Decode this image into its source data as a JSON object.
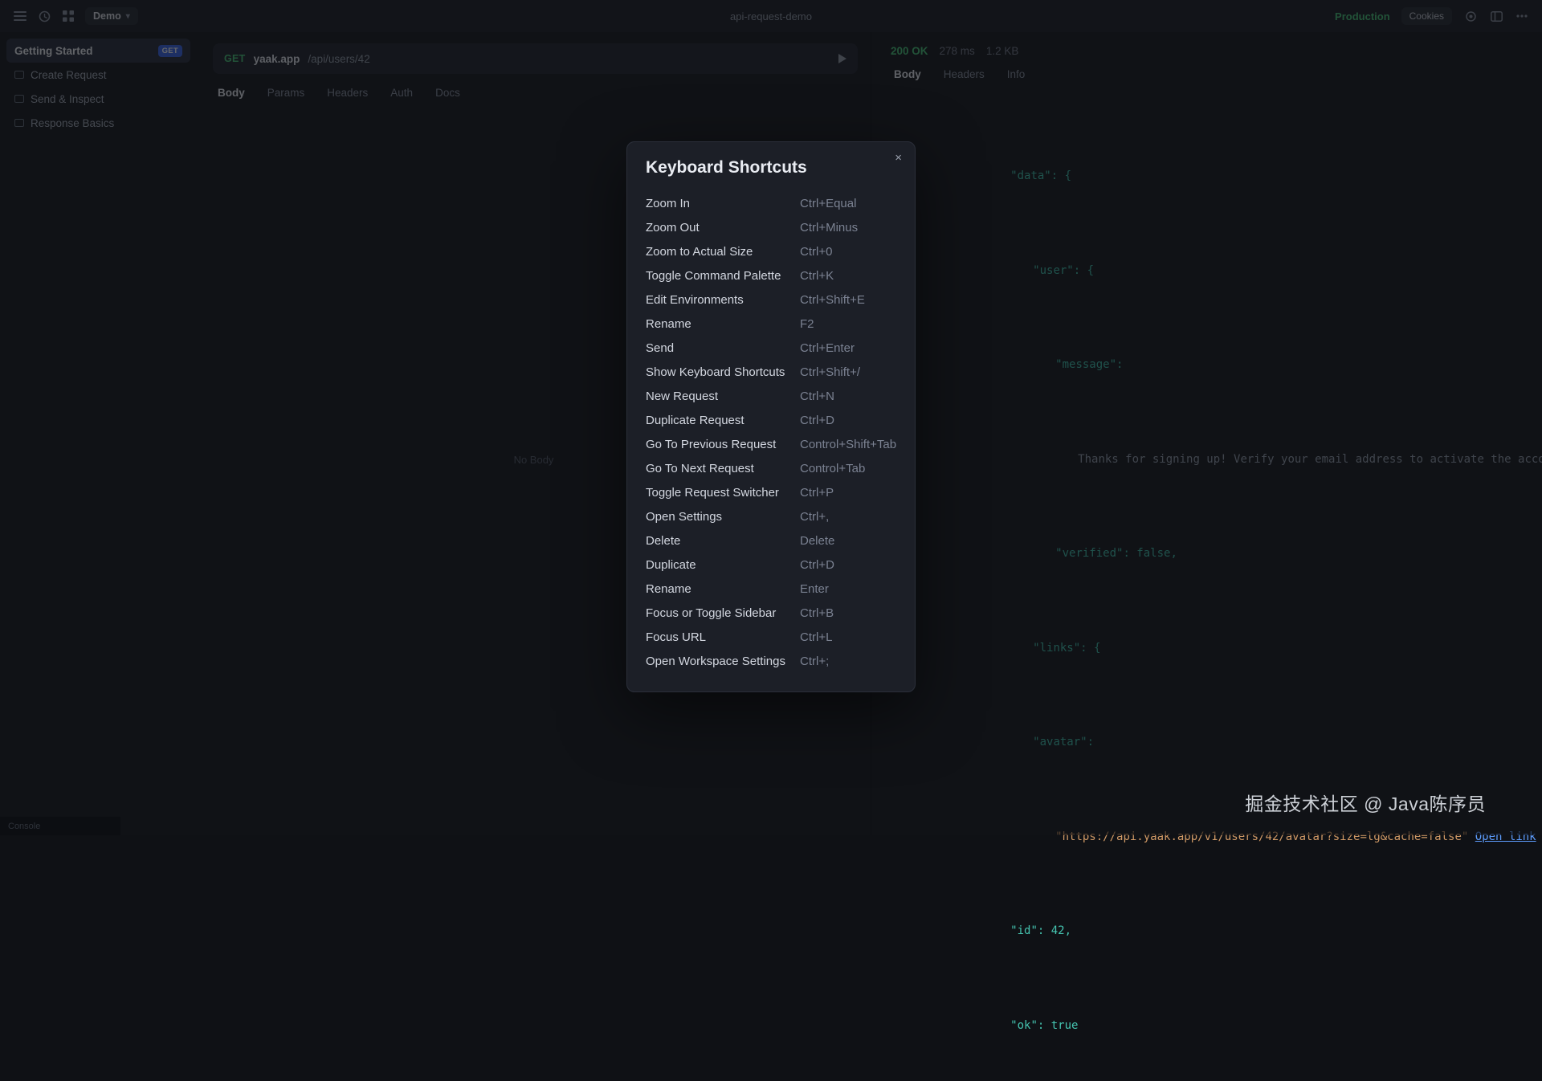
{
  "colors": {
    "accent_green": "#4ec97e",
    "method_green": "#4ec97e",
    "badge_blue": "#3f6cf0",
    "json_key": "#45c4b0",
    "json_string": "#d19a66",
    "json_link": "#5e9eff",
    "json_muted": "#9aa3b2"
  },
  "watermark": "掘金技术社区 @ Java陈序员",
  "topbar": {
    "workspace": "Demo",
    "document_title": "api-request-demo",
    "environment": "Production",
    "cookies_label": "Cookies"
  },
  "sidebar": {
    "items": [
      {
        "label": "Getting Started",
        "badge": "GET",
        "active": true
      },
      {
        "label": "Create Request",
        "icon": "folder"
      },
      {
        "label": "Send & Inspect",
        "icon": "folder"
      },
      {
        "label": "Response Basics",
        "icon": "file"
      }
    ]
  },
  "request": {
    "method": "GET",
    "url_host": "yaak.app",
    "url_path": "/api/users/42",
    "tabs": [
      {
        "label": "Body",
        "active": true
      },
      {
        "label": "Params"
      },
      {
        "label": "Headers"
      },
      {
        "label": "Auth"
      },
      {
        "label": "Docs"
      }
    ],
    "empty_state": "No Body"
  },
  "response": {
    "status": "200 OK",
    "time": "278 ms",
    "size": "1.2 KB",
    "tabs": [
      {
        "label": "Body",
        "active": true
      },
      {
        "label": "Headers"
      },
      {
        "label": "Info"
      }
    ],
    "body_lines": [
      {
        "indent": 0,
        "parts": [
          {
            "t": "\"data\": {",
            "c": "key"
          }
        ]
      },
      {
        "indent": 1,
        "parts": [
          {
            "t": "\"user\": {",
            "c": "key"
          }
        ]
      },
      {
        "indent": 2,
        "parts": [
          {
            "t": "\"message\":",
            "c": "key"
          }
        ]
      },
      {
        "indent": 3,
        "parts": [
          {
            "t": "Thanks for signing up! Verify your email address to activate the account.",
            "c": "muted"
          }
        ]
      },
      {
        "indent": 2,
        "parts": [
          {
            "t": "\"verified\": false,",
            "c": "key"
          }
        ]
      },
      {
        "indent": 1,
        "parts": [
          {
            "t": "\"links\": {",
            "c": "key"
          }
        ]
      },
      {
        "indent": 1,
        "parts": [
          {
            "t": "\"avatar\":",
            "c": "key"
          }
        ]
      },
      {
        "indent": 2,
        "parts": [
          {
            "t": "\"https://api.yaak.app/v1/users/42/avatar?size=lg&cache=false\" ",
            "c": "str"
          },
          {
            "t": "Open link",
            "c": "link"
          }
        ]
      },
      {
        "indent": 0,
        "parts": [
          {
            "t": "\"id\": 42,",
            "c": "key"
          }
        ]
      },
      {
        "indent": 0,
        "parts": [
          {
            "t": "\"ok\": true",
            "c": "key"
          }
        ]
      }
    ]
  },
  "statusbar": {
    "label": "Console"
  },
  "modal": {
    "title": "Keyboard Shortcuts",
    "close_label": "×",
    "shortcuts": [
      {
        "label": "Zoom In",
        "keys": "Ctrl+Equal"
      },
      {
        "label": "Zoom Out",
        "keys": "Ctrl+Minus"
      },
      {
        "label": "Zoom to Actual Size",
        "keys": "Ctrl+0"
      },
      {
        "label": "Toggle Command Palette",
        "keys": "Ctrl+K"
      },
      {
        "label": "Edit Environments",
        "keys": "Ctrl+Shift+E"
      },
      {
        "label": "Rename",
        "keys": "F2"
      },
      {
        "label": "Send",
        "keys": "Ctrl+Enter"
      },
      {
        "label": "Show Keyboard Shortcuts",
        "keys": "Ctrl+Shift+/"
      },
      {
        "label": "New Request",
        "keys": "Ctrl+N"
      },
      {
        "label": "Duplicate Request",
        "keys": "Ctrl+D"
      },
      {
        "label": "Go To Previous Request",
        "keys": "Control+Shift+Tab"
      },
      {
        "label": "Go To Next Request",
        "keys": "Control+Tab"
      },
      {
        "label": "Toggle Request Switcher",
        "keys": "Ctrl+P"
      },
      {
        "label": "Open Settings",
        "keys": "Ctrl+,"
      },
      {
        "label": "Delete",
        "keys": "Delete"
      },
      {
        "label": "Duplicate",
        "keys": "Ctrl+D"
      },
      {
        "label": "Rename",
        "keys": "Enter"
      },
      {
        "label": "Focus or Toggle Sidebar",
        "keys": "Ctrl+B"
      },
      {
        "label": "Focus URL",
        "keys": "Ctrl+L"
      },
      {
        "label": "Open Workspace Settings",
        "keys": "Ctrl+;"
      }
    ]
  }
}
